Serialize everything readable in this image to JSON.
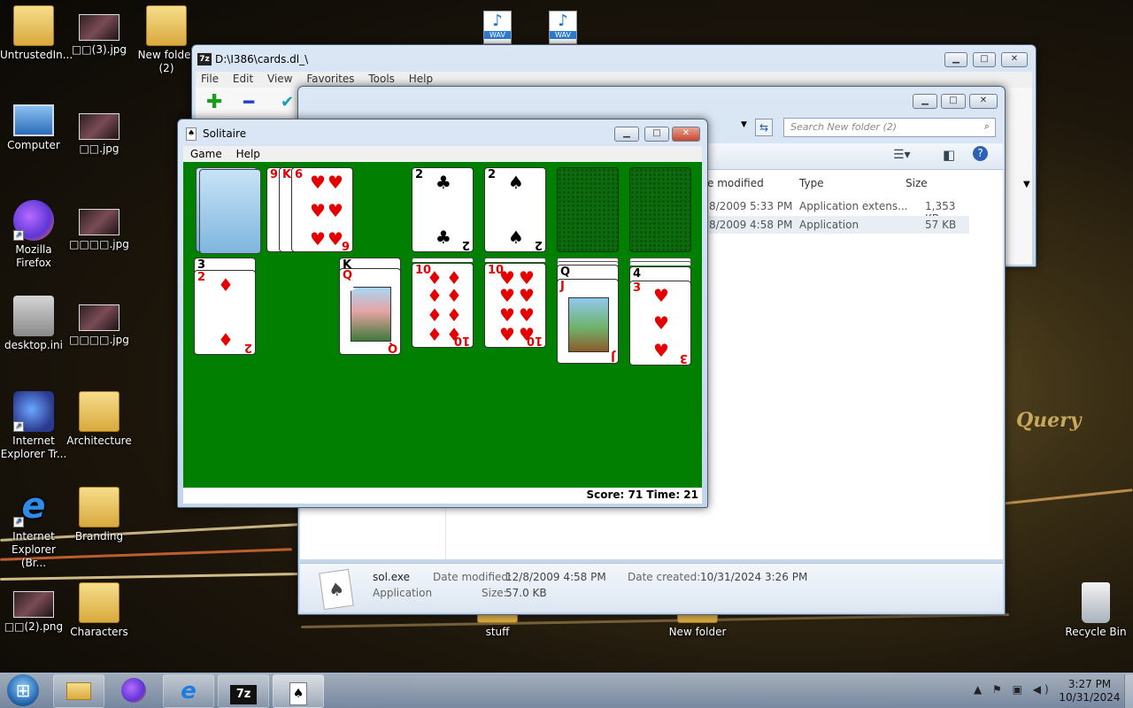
{
  "desktop": {
    "icons": [
      {
        "label": "UntrustedIn...",
        "kind": "folder"
      },
      {
        "label": "□□(3).jpg",
        "kind": "image"
      },
      {
        "label": "New folder (2)",
        "kind": "folder"
      },
      {
        "label": "Computer",
        "kind": "computer"
      },
      {
        "label": "□□.jpg",
        "kind": "image"
      },
      {
        "label": "Mozilla Firefox",
        "kind": "firefox"
      },
      {
        "label": "□□□□.jpg",
        "kind": "image"
      },
      {
        "label": "desktop.ini",
        "kind": "file"
      },
      {
        "label": "□□□□.jpg",
        "kind": "image"
      },
      {
        "label": "Internet Explorer Tr...",
        "kind": "app"
      },
      {
        "label": "Architecture",
        "kind": "folder"
      },
      {
        "label": "Internet Explorer (Br...",
        "kind": "ie"
      },
      {
        "label": "Branding",
        "kind": "folder"
      },
      {
        "label": "□□(2).png",
        "kind": "image"
      },
      {
        "label": "Characters",
        "kind": "folder"
      },
      {
        "label": "stuff",
        "kind": "folder"
      },
      {
        "label": "New folder",
        "kind": "folder"
      },
      {
        "label": "Recycle Bin",
        "kind": "recycle"
      }
    ],
    "wav_label": "WAV",
    "wallpaper_text": "Query"
  },
  "sevenzip": {
    "title": "D:\\I386\\cards.dl_\\",
    "logo": "7z",
    "menu": [
      "File",
      "Edit",
      "View",
      "Favorites",
      "Tools",
      "Help"
    ],
    "add_glyph": "✚",
    "remove_glyph": "━",
    "extract_glyph": "✔"
  },
  "explorer": {
    "search_placeholder": "Search New folder (2)",
    "columns": [
      "Date modified",
      "Type",
      "Size"
    ],
    "date_col_visible": "e modified",
    "rows": [
      {
        "date": "8/2009 5:33 PM",
        "type": "Application extens...",
        "size": "1,353 KB"
      },
      {
        "date": "8/2009 4:58 PM",
        "type": "Application",
        "size": "57 KB"
      }
    ],
    "details": {
      "name": "sol.exe",
      "type": "Application",
      "date_modified_label": "Date modified:",
      "date_modified": "12/8/2009 4:58 PM",
      "size_label": "Size:",
      "size": "57.0 KB",
      "date_created_label": "Date created:",
      "date_created": "10/31/2024 3:26 PM"
    }
  },
  "solitaire": {
    "title": "Solitaire",
    "menu": [
      "Game",
      "Help"
    ],
    "status": "Score: 71 Time: 21",
    "waste": [
      "9",
      "K",
      "6"
    ],
    "foundations": [
      {
        "rank": "2",
        "suit": "♣",
        "color": "blk"
      },
      {
        "rank": "2",
        "suit": "♠",
        "color": "blk"
      }
    ],
    "tableau": [
      {
        "top_rank": "2",
        "suit": "♦",
        "under": "3",
        "color": "red"
      },
      {
        "top_rank": "Q",
        "under": "K",
        "color": "red",
        "face": true
      },
      {
        "top_rank": "10",
        "suit": "♦",
        "color": "red"
      },
      {
        "top_rank": "10",
        "suit": "♥",
        "color": "red"
      },
      {
        "top_rank": "J",
        "under": "Q",
        "color": "red",
        "face": true
      },
      {
        "top_rank": "3",
        "suit": "♥",
        "under": "4",
        "color": "red"
      }
    ]
  },
  "taskbar": {
    "start_glyph": "⊞",
    "time": "3:27 PM",
    "date": "10/31/2024",
    "tray_glyphs": "▲ ⚑ ▣ ◀)"
  }
}
